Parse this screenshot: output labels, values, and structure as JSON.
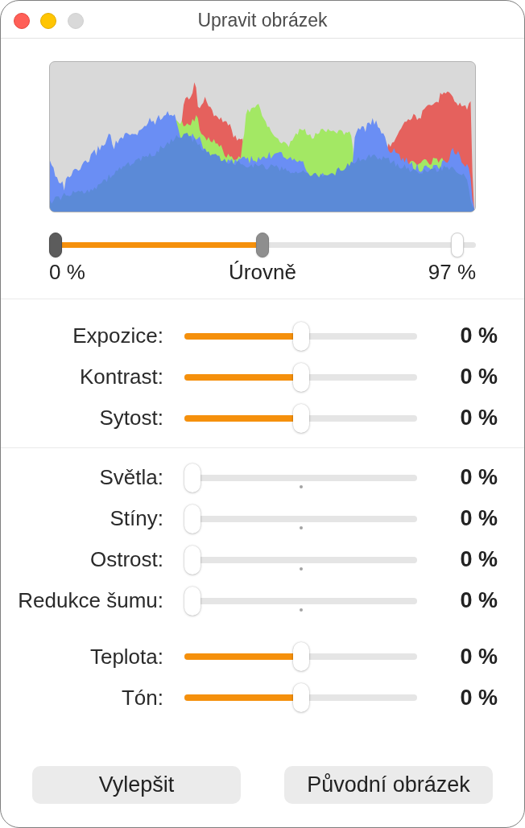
{
  "window": {
    "title": "Upravit obrázek",
    "zoom_enabled": false
  },
  "levels": {
    "handles": [
      {
        "kind": "black",
        "level": 0
      },
      {
        "kind": "gray",
        "level": 0.5
      },
      {
        "kind": "white",
        "level": 0.97
      }
    ],
    "min_reading": "0 %",
    "label": "Úrovně",
    "max_reading": "97 %"
  },
  "groups": [
    {
      "sliders": [
        {
          "label": "Expozice:",
          "level": 0.5,
          "center_tick": false,
          "reading": "0 %"
        },
        {
          "label": "Kontrast:",
          "level": 0.5,
          "center_tick": false,
          "reading": "0 %"
        },
        {
          "label": "Sytost:",
          "level": 0.5,
          "center_tick": false,
          "reading": "0 %"
        }
      ]
    },
    {
      "divider": true,
      "sliders": [
        {
          "label": "Světla:",
          "level": 0,
          "center_tick": true,
          "reading": "0 %"
        },
        {
          "label": "Stíny:",
          "level": 0,
          "center_tick": true,
          "reading": "0 %"
        },
        {
          "label": "Ostrost:",
          "level": 0,
          "center_tick": true,
          "reading": "0 %"
        },
        {
          "label": "Redukce šumu:",
          "level": 0,
          "center_tick": true,
          "reading": "0 %"
        }
      ]
    },
    {
      "divider": false,
      "sliders": [
        {
          "label": "Teplota:",
          "level": 0.5,
          "center_tick": false,
          "reading": "0 %"
        },
        {
          "label": "Tón:",
          "level": 0.5,
          "center_tick": false,
          "reading": "0 %"
        }
      ]
    }
  ],
  "buttons": [
    {
      "label": "Vylepšit"
    },
    {
      "label": "Původní obrázek"
    }
  ]
}
